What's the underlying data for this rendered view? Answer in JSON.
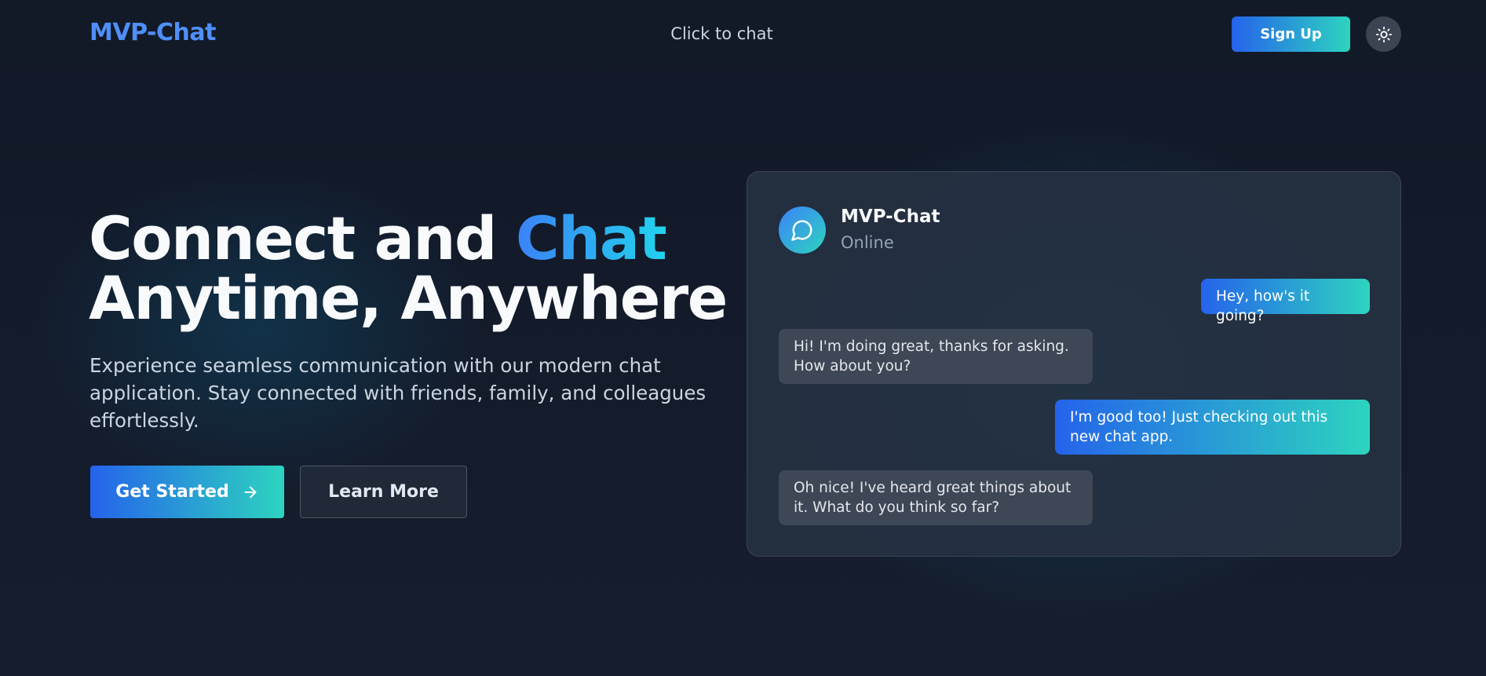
{
  "nav": {
    "brand": "MVP-Chat",
    "center_link": "Click to chat",
    "signup_label": "Sign Up",
    "theme_toggle_icon": "sun-icon"
  },
  "hero": {
    "title_part1": "Connect and ",
    "title_accent": "Chat",
    "title_line2": "Anytime, Anywhere",
    "subtitle": "Experience seamless communication with our modern chat application. Stay connected with friends, family, and colleagues effortlessly.",
    "primary_button": "Get Started",
    "primary_button_icon": "arrow-right-icon",
    "secondary_button": "Learn More"
  },
  "chat_preview": {
    "avatar_icon": "chat-bubble-icon",
    "name": "MVP-Chat",
    "status": "Online",
    "messages": [
      {
        "direction": "outgoing",
        "text": "Hey, how's it going?"
      },
      {
        "direction": "incoming",
        "text": "Hi! I'm doing great, thanks for asking. How about you?"
      },
      {
        "direction": "outgoing",
        "text": "I'm good too! Just checking out this new chat app."
      },
      {
        "direction": "incoming",
        "text": "Oh nice! I've heard great things about it. What do you think so far?"
      }
    ]
  },
  "colors": {
    "background": "#111827",
    "brand_blue": "#4f8ff7",
    "gradient_start": "#2563eb",
    "gradient_end": "#2dd4bf",
    "card_background": "#263142",
    "incoming_bubble": "#3d4756"
  }
}
